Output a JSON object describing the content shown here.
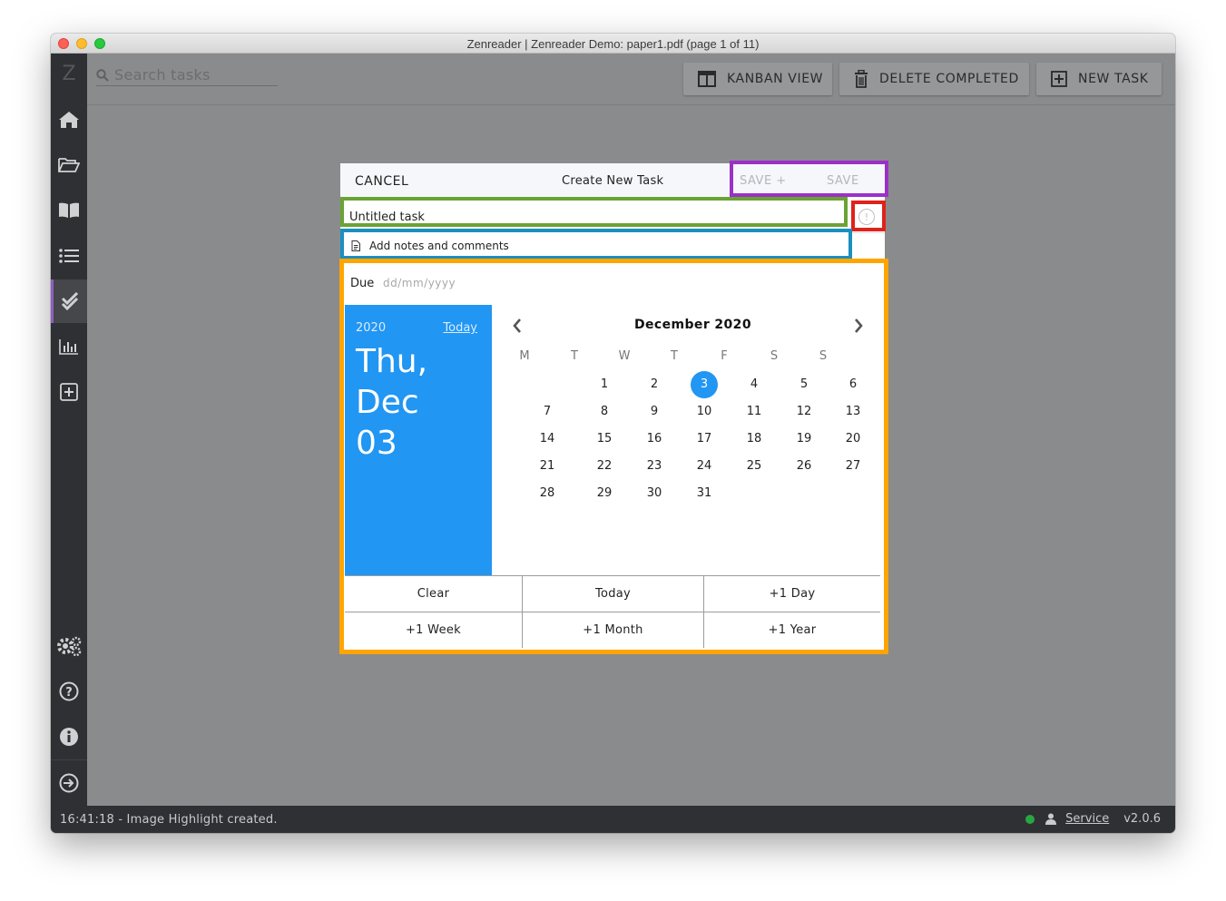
{
  "window": {
    "title": "Zenreader | Zenreader Demo: paper1.pdf (page 1 of 11)"
  },
  "sidebar": {
    "logo": "Z",
    "items": [
      {
        "icon": "home-icon"
      },
      {
        "icon": "folder-open-icon"
      },
      {
        "icon": "book-icon"
      },
      {
        "icon": "list-icon"
      },
      {
        "icon": "tasks-check-icon",
        "active": true
      },
      {
        "icon": "chart-icon"
      },
      {
        "icon": "plus-square-icon"
      }
    ],
    "bottom_items": [
      {
        "icon": "settings-gears-icon"
      },
      {
        "icon": "help-icon"
      },
      {
        "icon": "info-icon"
      },
      {
        "icon": "logout-icon"
      }
    ],
    "active_accent": "#8e5fbf"
  },
  "topbar": {
    "search_placeholder": "Search tasks",
    "kanban_label": "KANBAN VIEW",
    "delete_completed_label": "DELETE COMPLETED",
    "new_task_label": "NEW TASK"
  },
  "dialog": {
    "cancel_label": "CANCEL",
    "title": "Create New Task",
    "save_plus_label": "SAVE +",
    "save_label": "SAVE",
    "task_title_value": "Untitled task",
    "notes_placeholder": "Add notes and comments",
    "alert_glyph": "!",
    "due_label": "Due",
    "due_placeholder": "dd/mm/yyyy"
  },
  "datepicker": {
    "year": "2020",
    "today_link": "Today",
    "big_line1": "Thu,",
    "big_line2": "Dec",
    "big_line3": "03",
    "month_label": "December 2020",
    "weekdays": [
      "M",
      "T",
      "W",
      "T",
      "F",
      "S",
      "S"
    ],
    "first_weekday_index": 1,
    "days_in_month": 31,
    "selected_day": 3,
    "accent_color": "#2196f3",
    "quick_buttons": [
      "Clear",
      "Today",
      "+1 Day",
      "+1 Week",
      "+1 Month",
      "+1 Year"
    ]
  },
  "status": {
    "message": "16:41:18 - Image Highlight created.",
    "service_label": "Service",
    "version": "v2.0.6",
    "indicator_color": "#2aa641"
  },
  "highlights": {
    "save_box_color": "#9b30c9",
    "title_box_color": "#6aa334",
    "alert_box_color": "#e0221a",
    "notes_box_color": "#1c8fbf",
    "datepicker_box_color": "#ffa500"
  }
}
